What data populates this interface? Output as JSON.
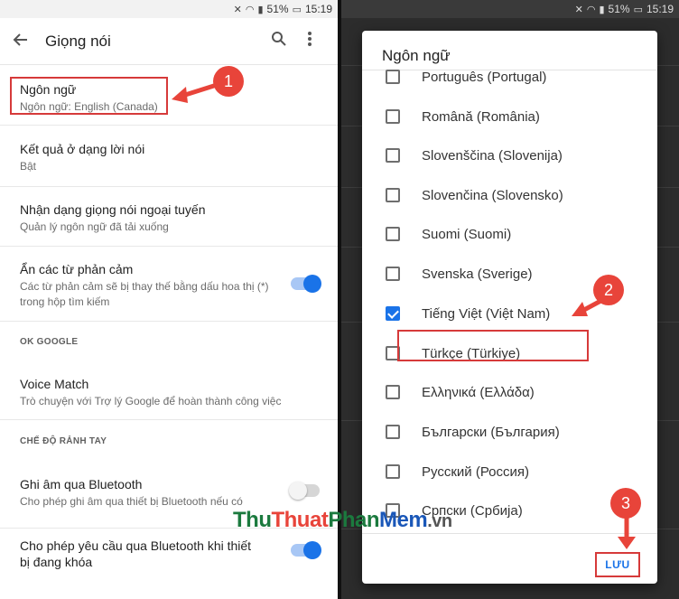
{
  "status": {
    "signal": "51%",
    "time": "15:19"
  },
  "left": {
    "title": "Giọng nói",
    "settings": [
      {
        "title": "Ngôn ngữ",
        "subtitle": "Ngôn ngữ: English (Canada)"
      },
      {
        "title": "Kết quả ở dạng lời nói",
        "subtitle": "Bật"
      },
      {
        "title": "Nhận dạng giọng nói ngoại tuyến",
        "subtitle": "Quản lý ngôn ngữ đã tải xuống"
      },
      {
        "title": "Ẩn các từ phản cảm",
        "subtitle": "Các từ phản cảm sẽ bị thay thế bằng dấu hoa thị (*) trong hộp tìm kiếm",
        "toggle": true
      },
      {
        "title": "Voice Match",
        "subtitle": "Trò chuyện với Trợ lý Google để hoàn thành công việc"
      },
      {
        "title": "Ghi âm qua Bluetooth",
        "subtitle": "Cho phép ghi âm qua thiết bị Bluetooth nếu có",
        "toggle": false
      },
      {
        "title": "Cho phép yêu cầu qua Bluetooth khi thiết bị đang khóa",
        "subtitle": "",
        "toggle": true
      }
    ],
    "sections": [
      "OK GOOGLE",
      "CHẾ ĐỘ RẢNH TAY"
    ]
  },
  "dialog": {
    "title": "Ngôn ngữ",
    "languages": [
      {
        "name": "Português (Portugal)",
        "checked": false
      },
      {
        "name": "Română (România)",
        "checked": false
      },
      {
        "name": "Slovenščina (Slovenija)",
        "checked": false
      },
      {
        "name": "Slovenčina (Slovensko)",
        "checked": false
      },
      {
        "name": "Suomi (Suomi)",
        "checked": false
      },
      {
        "name": "Svenska (Sverige)",
        "checked": false
      },
      {
        "name": "Tiếng Việt (Việt Nam)",
        "checked": true
      },
      {
        "name": "Türkçe (Türkiye)",
        "checked": false
      },
      {
        "name": "Ελληνικά (Ελλάδα)",
        "checked": false
      },
      {
        "name": "Български (България)",
        "checked": false
      },
      {
        "name": "Русский (Россия)",
        "checked": false
      },
      {
        "name": "Српски (Србија)",
        "checked": false
      }
    ],
    "save_label": "LƯU"
  },
  "callouts": [
    "1",
    "2",
    "3"
  ],
  "watermark": {
    "p1": "Thu",
    "p2": "Thuat",
    "p3": "Phan",
    "p4": "Mem",
    "p5": ".vn"
  },
  "colors": {
    "accent": "#1a73e8",
    "callout": "#e8443a",
    "highlight": "#d63a3a"
  }
}
